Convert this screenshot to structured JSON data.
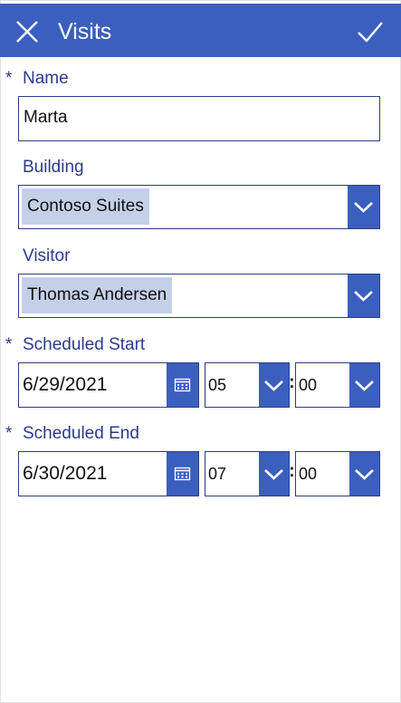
{
  "header": {
    "title": "Visits",
    "close_icon": "close-icon",
    "submit_icon": "checkmark-icon",
    "color": "#3b5fbf"
  },
  "form": {
    "required_marker": "*",
    "name": {
      "label": "Name",
      "value": "Marta",
      "required": true
    },
    "building": {
      "label": "Building",
      "selected": "Contoso Suites"
    },
    "visitor": {
      "label": "Visitor",
      "selected": "Thomas Andersen"
    },
    "scheduled_start": {
      "label": "Scheduled Start",
      "required": true,
      "date": "6/29/2021",
      "hour": "05",
      "minute": "00"
    },
    "scheduled_end": {
      "label": "Scheduled End",
      "required": true,
      "date": "6/30/2021",
      "hour": "07",
      "minute": "00"
    },
    "time_separator": ":"
  },
  "colors": {
    "accent": "#3b5fbf",
    "label": "#2d3a8c",
    "chip": "#c4cfe8",
    "border": "#2f3d80"
  }
}
